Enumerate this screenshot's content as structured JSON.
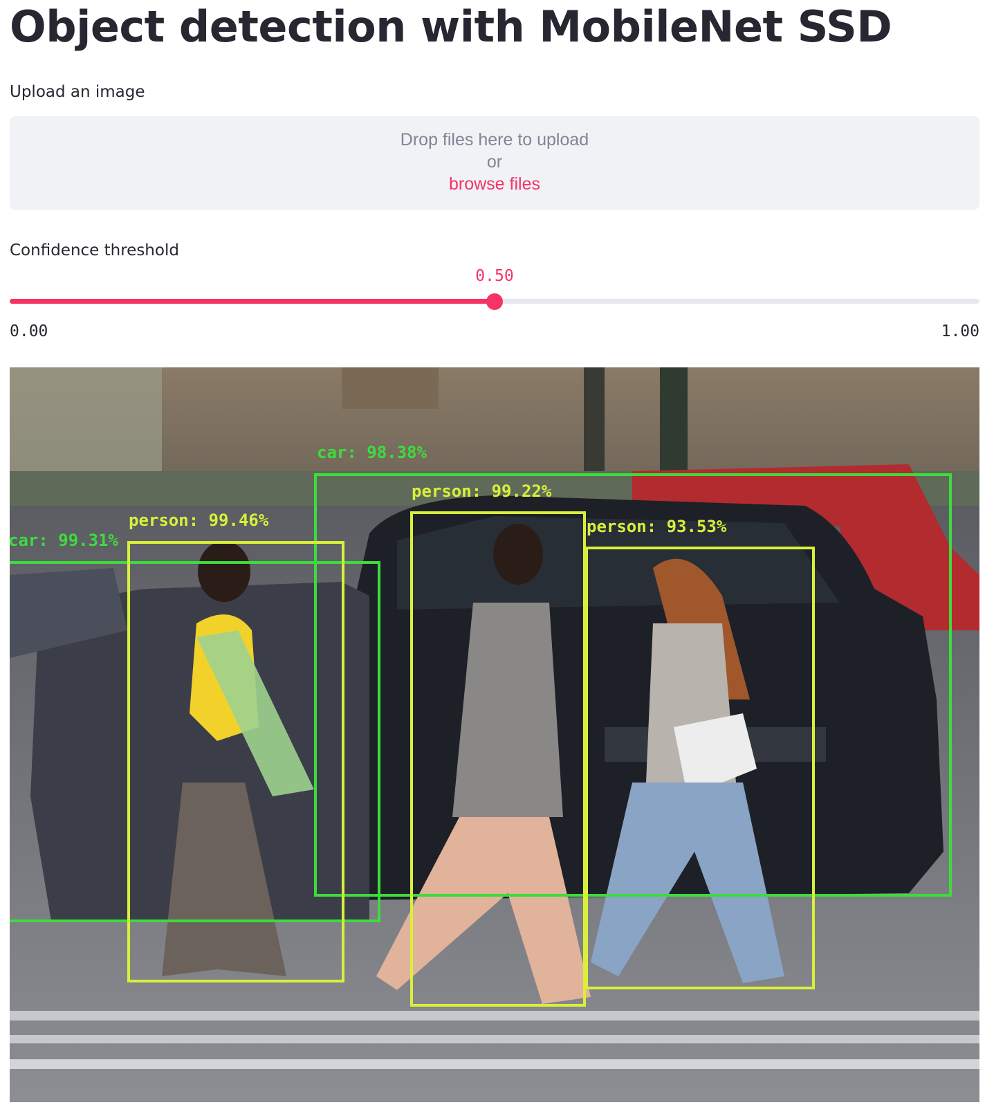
{
  "page": {
    "title": "Object detection with MobileNet SSD"
  },
  "uploader": {
    "label": "Upload an image",
    "drop_text": "Drop files here to upload",
    "or_text": "or",
    "browse_text": "browse files"
  },
  "slider": {
    "label": "Confidence threshold",
    "value": 0.5,
    "value_text": "0.50",
    "min_text": "0.00",
    "max_text": "1.00",
    "accent_color": "#f63366"
  },
  "result_image": {
    "detections": [
      {
        "label": "car: 98.38%",
        "box_color": "#3ddc3d"
      },
      {
        "label": "car: 99.31%",
        "box_color": "#3ddc3d"
      },
      {
        "label": "person: 99.46%",
        "box_color": "#d9f03a"
      },
      {
        "label": "person: 99.22%",
        "box_color": "#d9f03a"
      },
      {
        "label": "person: 93.53%",
        "box_color": "#d9f03a"
      }
    ]
  }
}
